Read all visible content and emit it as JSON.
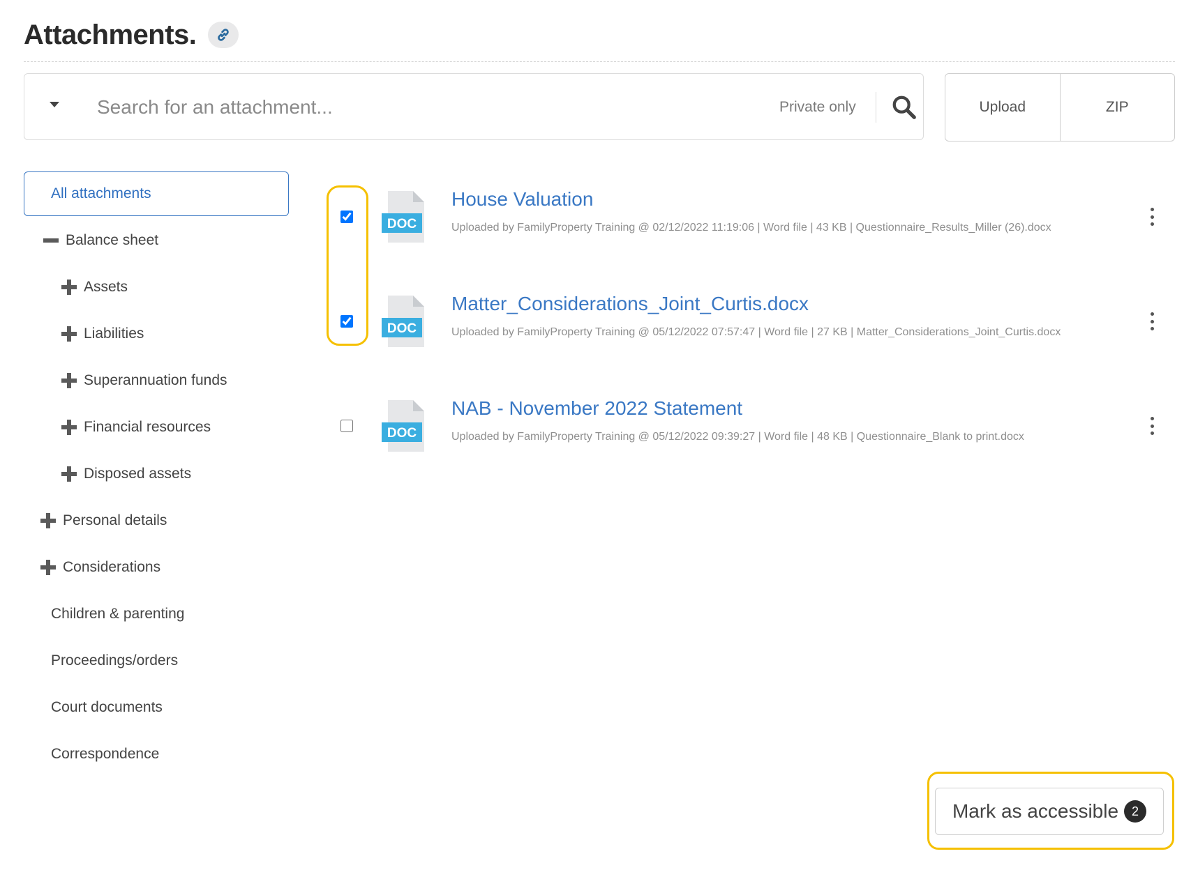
{
  "header": {
    "title": "Attachments.",
    "link_icon": "link-icon"
  },
  "search": {
    "placeholder": "Search for an attachment...",
    "value": "",
    "private_only_label": "Private only",
    "search_icon": "magnifier-icon"
  },
  "toolbar": {
    "upload_label": "Upload",
    "zip_label": "ZIP"
  },
  "sidebar": {
    "all_label": "All attachments",
    "items": [
      {
        "label": "Balance sheet",
        "icon": "minus-icon"
      },
      {
        "label": "Assets",
        "icon": "plus-icon"
      },
      {
        "label": "Liabilities",
        "icon": "plus-icon"
      },
      {
        "label": "Superannuation funds",
        "icon": "plus-icon"
      },
      {
        "label": "Financial resources",
        "icon": "plus-icon"
      },
      {
        "label": "Disposed assets",
        "icon": "plus-icon"
      },
      {
        "label": "Personal details",
        "icon": "plus-icon"
      },
      {
        "label": "Considerations",
        "icon": "plus-icon"
      },
      {
        "label": "Children & parenting"
      },
      {
        "label": "Proceedings/orders"
      },
      {
        "label": "Court documents"
      },
      {
        "label": "Correspondence"
      }
    ]
  },
  "attachments": [
    {
      "title": "House Valuation",
      "meta": "Uploaded by FamilyProperty Training @ 02/12/2022 11:19:06 | Word file | 43 KB | Questionnaire_Results_Miller (26).docx",
      "checked": true,
      "type_label": "DOC"
    },
    {
      "title": "Matter_Considerations_Joint_Curtis.docx",
      "meta": "Uploaded by FamilyProperty Training @ 05/12/2022 07:57:47 | Word file | 27 KB | Matter_Considerations_Joint_Curtis.docx",
      "checked": true,
      "type_label": "DOC"
    },
    {
      "title": "NAB - November 2022 Statement",
      "meta": "Uploaded by FamilyProperty Training @ 05/12/2022 09:39:27 | Word file | 48 KB | Questionnaire_Blank to print.docx",
      "checked": false,
      "type_label": "DOC"
    }
  ],
  "actions": {
    "mark_accessible_label": "Mark as accessible",
    "selected_count": "2"
  },
  "colors": {
    "accent": "#3a78c4",
    "highlight": "#f5c000",
    "doc_badge": "#3aaee0"
  }
}
